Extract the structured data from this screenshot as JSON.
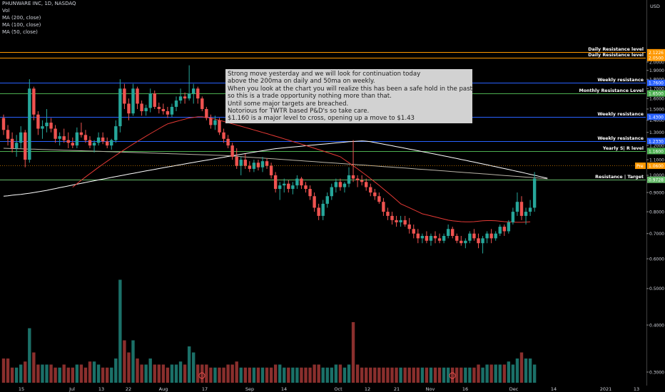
{
  "header": {
    "symbol": "PHUNWARE INC, 1D, NASDAQ",
    "indicators": [
      "Vol",
      "MA (200, close)",
      "MA (100, close)",
      "MA (50, close)"
    ]
  },
  "currency": "USD",
  "colors": {
    "up": "#26a69a",
    "down": "#ef5350",
    "ma200": "#ffffff",
    "ma100": "#b8b3a6",
    "ma50": "#e53935",
    "resistance_orange": "#ff9800",
    "blue": "#2962ff",
    "green": "#4caf50",
    "target_green": "#66bb6a"
  },
  "note": {
    "lines": [
      "Strong move yesterday and we will look for continuation today",
      "above the 200ma on daily and 50ma on weekly.",
      "When you look at the chart you will realize this has been a safe hold in the past",
      "so this is a trade opportunity nothing more than that.",
      "Until some major targets are breached.",
      "Notorious for TWTR based P&D's so take care.",
      "$1.160 is a major level to cross, opening up a move to $1.43"
    ]
  },
  "chart_data": {
    "type": "candlestick",
    "title": "PHUNWARE INC, 1D, NASDAQ",
    "y_scale": "log",
    "ylim": [
      0.28,
      2.3
    ],
    "y_ticks": [
      "2.0000",
      "1.9000",
      "1.8000",
      "1.7000",
      "1.6000",
      "1.5000",
      "1.4000",
      "1.3000",
      "1.2000",
      "1.1000",
      "1.0000",
      "0.9000",
      "0.8000",
      "0.7000",
      "0.6000",
      "0.5000",
      "0.4000",
      "0.3000"
    ],
    "x_ticks": [
      "15",
      "Jul",
      "13",
      "22",
      "Aug",
      "17",
      "Sep",
      "14",
      "Oct",
      "12",
      "21",
      "Nov",
      "16",
      "Dec",
      "14",
      "2021",
      "13"
    ],
    "levels": [
      {
        "value": 2.1226,
        "label": "Daily Resistance level",
        "tag": "2.1226",
        "color": "#ff9800"
      },
      {
        "value": 2.05,
        "label": "Daily Resistance level",
        "tag": "2.0500",
        "color": "#ff9800"
      },
      {
        "value": 1.76,
        "label": "Weekly resistance",
        "tag": "1.7600",
        "color": "#2962ff"
      },
      {
        "value": 1.65,
        "label": "Monthly Resistance Level",
        "tag": "1.6500",
        "color": "#4caf50"
      },
      {
        "value": 1.43,
        "label": "Weekly resistance",
        "tag": "1.4300",
        "color": "#2962ff"
      },
      {
        "value": 1.233,
        "label": "Weekly resistance",
        "tag": "1.2330",
        "color": "#2962ff"
      },
      {
        "value": 1.16,
        "label": "Yearly  S| R level",
        "tag": "1.1600",
        "color": "#4caf50"
      },
      {
        "value": 0.9728,
        "label": "Resistance | Target",
        "tag": "0.9728",
        "color": "#66bb6a"
      }
    ],
    "price_tags": [
      {
        "value": 1.06,
        "text": "1.0600",
        "badge": "Pre",
        "color": "#ff9800"
      }
    ],
    "ohlc": [
      [
        1.42,
        1.45,
        1.28,
        1.32
      ],
      [
        1.32,
        1.36,
        1.2,
        1.25
      ],
      [
        1.25,
        1.3,
        1.15,
        1.18
      ],
      [
        1.18,
        1.28,
        1.12,
        1.22
      ],
      [
        1.22,
        1.35,
        1.18,
        1.3
      ],
      [
        1.3,
        1.32,
        1.05,
        1.1
      ],
      [
        1.1,
        1.8,
        1.08,
        1.7
      ],
      [
        1.7,
        1.72,
        1.4,
        1.45
      ],
      [
        1.45,
        1.48,
        1.28,
        1.33
      ],
      [
        1.33,
        1.4,
        1.25,
        1.35
      ],
      [
        1.35,
        1.5,
        1.3,
        1.38
      ],
      [
        1.38,
        1.42,
        1.3,
        1.33
      ],
      [
        1.33,
        1.36,
        1.22,
        1.25
      ],
      [
        1.25,
        1.3,
        1.2,
        1.27
      ],
      [
        1.27,
        1.33,
        1.22,
        1.24
      ],
      [
        1.24,
        1.3,
        1.18,
        1.22
      ],
      [
        1.22,
        1.26,
        1.18,
        1.2
      ],
      [
        1.2,
        1.34,
        1.18,
        1.3
      ],
      [
        1.3,
        1.38,
        1.26,
        1.28
      ],
      [
        1.28,
        1.32,
        1.22,
        1.24
      ],
      [
        1.24,
        1.27,
        1.18,
        1.2
      ],
      [
        1.2,
        1.24,
        1.15,
        1.22
      ],
      [
        1.22,
        1.3,
        1.2,
        1.26
      ],
      [
        1.26,
        1.3,
        1.21,
        1.23
      ],
      [
        1.23,
        1.26,
        1.18,
        1.2
      ],
      [
        1.2,
        1.25,
        1.17,
        1.24
      ],
      [
        1.24,
        1.4,
        1.22,
        1.35
      ],
      [
        1.35,
        1.8,
        1.3,
        1.7
      ],
      [
        1.7,
        1.75,
        1.5,
        1.55
      ],
      [
        1.55,
        1.6,
        1.4,
        1.46
      ],
      [
        1.46,
        1.75,
        1.44,
        1.7
      ],
      [
        1.7,
        1.72,
        1.5,
        1.55
      ],
      [
        1.55,
        1.58,
        1.44,
        1.48
      ],
      [
        1.48,
        1.54,
        1.44,
        1.51
      ],
      [
        1.51,
        1.7,
        1.47,
        1.65
      ],
      [
        1.65,
        1.68,
        1.5,
        1.52
      ],
      [
        1.52,
        1.56,
        1.46,
        1.5
      ],
      [
        1.5,
        1.55,
        1.45,
        1.48
      ],
      [
        1.48,
        1.52,
        1.42,
        1.45
      ],
      [
        1.45,
        1.55,
        1.43,
        1.52
      ],
      [
        1.52,
        1.62,
        1.48,
        1.58
      ],
      [
        1.58,
        1.7,
        1.55,
        1.62
      ],
      [
        1.62,
        1.66,
        1.55,
        1.6
      ],
      [
        1.6,
        1.96,
        1.58,
        1.65
      ],
      [
        1.65,
        1.75,
        1.55,
        1.7
      ],
      [
        1.7,
        1.72,
        1.55,
        1.6
      ],
      [
        1.6,
        1.62,
        1.48,
        1.5
      ],
      [
        1.5,
        1.52,
        1.4,
        1.42
      ],
      [
        1.42,
        1.45,
        1.33,
        1.36
      ],
      [
        1.36,
        1.44,
        1.32,
        1.4
      ],
      [
        1.4,
        1.42,
        1.28,
        1.3
      ],
      [
        1.3,
        1.33,
        1.22,
        1.25
      ],
      [
        1.25,
        1.28,
        1.18,
        1.2
      ],
      [
        1.2,
        1.22,
        1.1,
        1.12
      ],
      [
        1.12,
        1.18,
        1.04,
        1.06
      ],
      [
        1.06,
        1.12,
        1.0,
        1.1
      ],
      [
        1.1,
        1.14,
        1.04,
        1.06
      ],
      [
        1.06,
        1.09,
        1.02,
        1.04
      ],
      [
        1.04,
        1.1,
        1.02,
        1.08
      ],
      [
        1.08,
        1.1,
        1.03,
        1.05
      ],
      [
        1.05,
        1.12,
        1.02,
        1.09
      ],
      [
        1.09,
        1.11,
        1.04,
        1.06
      ],
      [
        1.06,
        1.08,
        0.98,
        1.0
      ],
      [
        1.0,
        1.02,
        0.9,
        0.92
      ],
      [
        0.92,
        0.96,
        0.86,
        0.94
      ],
      [
        0.94,
        0.98,
        0.9,
        0.95
      ],
      [
        0.95,
        0.97,
        0.9,
        0.92
      ],
      [
        0.92,
        0.96,
        0.89,
        0.94
      ],
      [
        0.94,
        1.0,
        0.92,
        0.98
      ],
      [
        0.98,
        0.99,
        0.92,
        0.94
      ],
      [
        0.94,
        0.96,
        0.9,
        0.92
      ],
      [
        0.92,
        0.94,
        0.86,
        0.88
      ],
      [
        0.88,
        0.9,
        0.8,
        0.82
      ],
      [
        0.82,
        0.84,
        0.76,
        0.78
      ],
      [
        0.78,
        0.86,
        0.76,
        0.84
      ],
      [
        0.84,
        0.9,
        0.82,
        0.88
      ],
      [
        0.88,
        0.95,
        0.86,
        0.93
      ],
      [
        0.93,
        0.98,
        0.9,
        0.96
      ],
      [
        0.96,
        0.98,
        0.91,
        0.93
      ],
      [
        0.93,
        0.96,
        0.9,
        0.95
      ],
      [
        0.95,
        1.05,
        0.93,
        1.0
      ],
      [
        1.0,
        1.24,
        0.96,
        0.98
      ],
      [
        0.98,
        1.0,
        0.93,
        0.97
      ],
      [
        0.97,
        1.0,
        0.94,
        0.96
      ],
      [
        0.96,
        0.98,
        0.91,
        0.93
      ],
      [
        0.93,
        0.95,
        0.88,
        0.9
      ],
      [
        0.9,
        0.92,
        0.86,
        0.88
      ],
      [
        0.88,
        0.9,
        0.84,
        0.85
      ],
      [
        0.85,
        0.87,
        0.78,
        0.8
      ],
      [
        0.8,
        0.82,
        0.76,
        0.78
      ],
      [
        0.78,
        0.8,
        0.74,
        0.76
      ],
      [
        0.76,
        0.78,
        0.73,
        0.75
      ],
      [
        0.75,
        0.78,
        0.73,
        0.76
      ],
      [
        0.76,
        0.78,
        0.73,
        0.74
      ],
      [
        0.74,
        0.77,
        0.7,
        0.72
      ],
      [
        0.72,
        0.74,
        0.68,
        0.7
      ],
      [
        0.7,
        0.72,
        0.66,
        0.68
      ],
      [
        0.68,
        0.7,
        0.66,
        0.69
      ],
      [
        0.69,
        0.71,
        0.66,
        0.67
      ],
      [
        0.67,
        0.7,
        0.65,
        0.69
      ],
      [
        0.69,
        0.71,
        0.66,
        0.68
      ],
      [
        0.68,
        0.7,
        0.66,
        0.67
      ],
      [
        0.67,
        0.7,
        0.66,
        0.69
      ],
      [
        0.69,
        0.74,
        0.68,
        0.72
      ],
      [
        0.72,
        0.73,
        0.68,
        0.69
      ],
      [
        0.69,
        0.7,
        0.66,
        0.67
      ],
      [
        0.67,
        0.69,
        0.65,
        0.66
      ],
      [
        0.66,
        0.68,
        0.64,
        0.67
      ],
      [
        0.67,
        0.71,
        0.66,
        0.7
      ],
      [
        0.7,
        0.72,
        0.67,
        0.68
      ],
      [
        0.68,
        0.7,
        0.64,
        0.66
      ],
      [
        0.66,
        0.69,
        0.62,
        0.68
      ],
      [
        0.68,
        0.71,
        0.66,
        0.7
      ],
      [
        0.7,
        0.72,
        0.66,
        0.68
      ],
      [
        0.68,
        0.71,
        0.67,
        0.7
      ],
      [
        0.7,
        0.74,
        0.69,
        0.73
      ],
      [
        0.73,
        0.74,
        0.69,
        0.71
      ],
      [
        0.71,
        0.76,
        0.7,
        0.75
      ],
      [
        0.75,
        0.82,
        0.74,
        0.8
      ],
      [
        0.8,
        0.9,
        0.78,
        0.85
      ],
      [
        0.85,
        0.88,
        0.76,
        0.78
      ],
      [
        0.78,
        0.82,
        0.74,
        0.8
      ],
      [
        0.8,
        0.86,
        0.78,
        0.82
      ],
      [
        0.82,
        1.02,
        0.8,
        0.98
      ]
    ],
    "volume_m": [
      4,
      4,
      2.5,
      2.5,
      3,
      3.5,
      9,
      5,
      3,
      3,
      3,
      3,
      2.5,
      2.5,
      3,
      2.5,
      2.5,
      3,
      3,
      2.5,
      3.5,
      3.5,
      3,
      2.5,
      2.5,
      2.5,
      4,
      17,
      7,
      5,
      7,
      4,
      3,
      3,
      4,
      3,
      3,
      3,
      2.5,
      3,
      3,
      3.5,
      3,
      6,
      5,
      3,
      3,
      3,
      2.5,
      2.5,
      2.5,
      2.5,
      3,
      3,
      3.5,
      2.5,
      2.5,
      2.5,
      2.5,
      2.5,
      2.5,
      2.5,
      2.5,
      3,
      3,
      2.5,
      2.5,
      2.5,
      2.5,
      2.5,
      2.5,
      2.5,
      3,
      3,
      2.5,
      2.5,
      2.5,
      3,
      3,
      2.5,
      3,
      10,
      3,
      2.5,
      2.5,
      2.5,
      2.5,
      2.5,
      2.5,
      2.5,
      2.5,
      2.5,
      2.5,
      2.5,
      2.5,
      2.5,
      2.5,
      2.5,
      2.5,
      2.5,
      2.5,
      2.5,
      2.5,
      2.5,
      2.5,
      2.5,
      2.5,
      2.5,
      2.5,
      2.5,
      3,
      2.5,
      3,
      3,
      3,
      3,
      3,
      3.5,
      3,
      4,
      5,
      4,
      4,
      3,
      3.5,
      12
    ],
    "ma200": [
      0.88,
      0.882,
      0.885,
      0.888,
      0.89,
      0.893,
      0.896,
      0.9,
      0.904,
      0.908,
      0.912,
      0.917,
      0.922,
      0.927,
      0.932,
      0.937,
      0.942,
      0.947,
      0.952,
      0.957,
      0.962,
      0.967,
      0.972,
      0.977,
      0.982,
      0.987,
      0.992,
      0.997,
      1.002,
      1.007,
      1.012,
      1.017,
      1.022,
      1.027,
      1.032,
      1.037,
      1.042,
      1.047,
      1.052,
      1.057,
      1.062,
      1.067,
      1.072,
      1.077,
      1.082,
      1.087,
      1.092,
      1.097,
      1.102,
      1.107,
      1.112,
      1.117,
      1.122,
      1.127,
      1.132,
      1.137,
      1.142,
      1.147,
      1.152,
      1.157,
      1.162,
      1.167,
      1.172,
      1.177,
      1.18,
      1.183,
      1.186,
      1.189,
      1.192,
      1.195,
      1.198,
      1.201,
      1.204,
      1.207,
      1.21,
      1.213,
      1.216,
      1.219,
      1.222,
      1.225,
      1.228,
      1.23,
      1.232,
      1.234,
      1.232,
      1.228,
      1.222,
      1.216,
      1.21,
      1.204,
      1.198,
      1.192,
      1.186,
      1.18,
      1.174,
      1.168,
      1.162,
      1.156,
      1.15,
      1.144,
      1.138,
      1.132,
      1.126,
      1.12,
      1.114,
      1.108,
      1.102,
      1.096,
      1.09,
      1.084,
      1.078,
      1.072,
      1.066,
      1.06,
      1.054,
      1.048,
      1.042,
      1.036,
      1.03,
      1.024,
      1.018,
      1.012,
      1.006,
      1,
      0.994,
      0.988,
      0.982
    ],
    "ma100": [
      1.18,
      1.179,
      1.178,
      1.177,
      1.176,
      1.175,
      1.174,
      1.173,
      1.172,
      1.171,
      1.17,
      1.169,
      1.168,
      1.167,
      1.166,
      1.165,
      1.164,
      1.163,
      1.162,
      1.161,
      1.16,
      1.159,
      1.158,
      1.157,
      1.156,
      1.155,
      1.154,
      1.153,
      1.152,
      1.151,
      1.15,
      1.149,
      1.148,
      1.147,
      1.146,
      1.145,
      1.144,
      1.143,
      1.142,
      1.141,
      1.14,
      1.139,
      1.138,
      1.137,
      1.136,
      1.135,
      1.134,
      1.133,
      1.132,
      1.131,
      1.13,
      1.129,
      1.127,
      1.125,
      1.123,
      1.121,
      1.119,
      1.117,
      1.115,
      1.113,
      1.111,
      1.109,
      1.107,
      1.105,
      1.103,
      1.101,
      1.099,
      1.097,
      1.095,
      1.093,
      1.091,
      1.089,
      1.087,
      1.085,
      1.083,
      1.081,
      1.079,
      1.077,
      1.075,
      1.073,
      1.071,
      1.069,
      1.067,
      1.065,
      1.063,
      1.061,
      1.059,
      1.057,
      1.055,
      1.053,
      1.051,
      1.049,
      1.047,
      1.045,
      1.043,
      1.041,
      1.039,
      1.037,
      1.035,
      1.033,
      1.031,
      1.029,
      1.027,
      1.025,
      1.023,
      1.021,
      1.019,
      1.017,
      1.015,
      1.013,
      1.011,
      1.009,
      1.007,
      1.005,
      1.003,
      1.001,
      0.999,
      0.997,
      0.995,
      0.993,
      0.991,
      0.989,
      0.987,
      0.985,
      0.983,
      0.981,
      0.979
    ],
    "ma50_start_index": 16,
    "ma50": [
      0.93,
      0.95,
      0.97,
      0.99,
      1.01,
      1.03,
      1.05,
      1.07,
      1.09,
      1.11,
      1.13,
      1.15,
      1.17,
      1.19,
      1.21,
      1.23,
      1.25,
      1.27,
      1.29,
      1.31,
      1.33,
      1.35,
      1.37,
      1.38,
      1.39,
      1.4,
      1.41,
      1.42,
      1.425,
      1.43,
      1.43,
      1.425,
      1.42,
      1.41,
      1.4,
      1.39,
      1.38,
      1.37,
      1.36,
      1.35,
      1.34,
      1.33,
      1.32,
      1.31,
      1.3,
      1.29,
      1.28,
      1.27,
      1.26,
      1.25,
      1.24,
      1.23,
      1.22,
      1.21,
      1.2,
      1.19,
      1.18,
      1.17,
      1.16,
      1.15,
      1.14,
      1.13,
      1.12,
      1.1,
      1.08,
      1.06,
      1.04,
      1.02,
      1,
      0.98,
      0.96,
      0.94,
      0.92,
      0.9,
      0.88,
      0.86,
      0.84,
      0.83,
      0.82,
      0.81,
      0.8,
      0.79,
      0.785,
      0.78,
      0.775,
      0.77,
      0.765,
      0.76,
      0.757,
      0.755,
      0.753,
      0.752,
      0.752,
      0.753,
      0.755,
      0.757,
      0.758,
      0.758,
      0.757,
      0.755,
      0.753,
      0.752,
      0.751,
      0.75,
      0.75,
      0.751,
      0.752
    ]
  }
}
